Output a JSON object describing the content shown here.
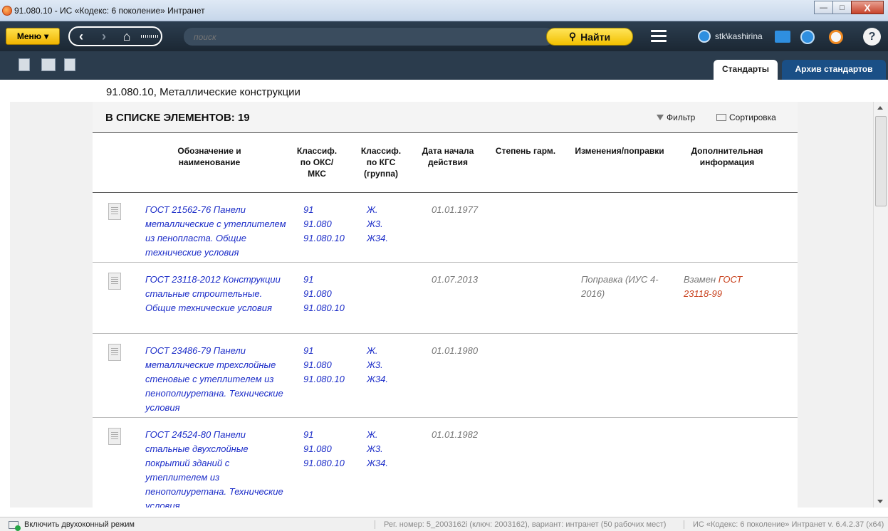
{
  "window": {
    "title": "91.080.10 - ИС «Кодекс: 6 поколение» Интранет",
    "min_label": "—",
    "max_label": "□",
    "close_label": "X"
  },
  "toolbar": {
    "menu_label": "Меню",
    "search_placeholder": "поиск",
    "search_button": "Найти",
    "user": "stk\\kashirina"
  },
  "tabs": [
    "Стандарты",
    "Архив стандартов"
  ],
  "breadcrumb": "91.080.10, Металлические конструкции",
  "list": {
    "count_label": "В СПИСКЕ ЭЛЕМЕНТОВ: 19",
    "filter_label": "Фильтр",
    "sort_label": "Сортировка",
    "columns": [
      "Обозначение и наименование",
      "Классиф. по ОКС/МКС",
      "Классиф. по КГС (группа)",
      "Дата начала действия",
      "Степень гарм.",
      "Изменения/поправки",
      "Дополнительная информация"
    ],
    "rows": [
      {
        "name": "ГОСТ 21562-76 Панели металлические с утеплителем из пенопласта. Общие технические условия",
        "oks": [
          "91",
          "91.080",
          "91.080.10"
        ],
        "kgs": [
          "Ж.",
          "Ж3.",
          "Ж34."
        ],
        "date": "01.01.1977",
        "harm": "",
        "changes": "",
        "info_prefix": "",
        "info_link": ""
      },
      {
        "name": "ГОСТ 23118-2012 Конструкции стальные строительные. Общие технические условия",
        "oks": [
          "91",
          "91.080",
          "91.080.10"
        ],
        "kgs": [],
        "date": "01.07.2013",
        "harm": "",
        "changes": "Поправка (ИУС 4-2016)",
        "info_prefix": "Взамен ",
        "info_link": "ГОСТ 23118-99"
      },
      {
        "name": "ГОСТ 23486-79 Панели металлические трехслойные стеновые с утеплителем из пенополиуретана. Технические условия",
        "oks": [
          "91",
          "91.080",
          "91.080.10"
        ],
        "kgs": [
          "Ж.",
          "Ж3.",
          "Ж34."
        ],
        "date": "01.01.1980",
        "harm": "",
        "changes": "",
        "info_prefix": "",
        "info_link": ""
      },
      {
        "name": "ГОСТ 24524-80 Панели стальные двухслойные покрытий зданий с утеплителем из пенополиуретана. Технические условия",
        "oks": [
          "91",
          "91.080",
          "91.080.10"
        ],
        "kgs": [
          "Ж.",
          "Ж3.",
          "Ж34."
        ],
        "date": "01.01.1982",
        "harm": "",
        "changes": "",
        "info_prefix": "",
        "info_link": ""
      }
    ]
  },
  "statusbar": {
    "dual_mode": "Включить двухоконный режим",
    "registration": "Рег. номер: 5_2003162i (ключ: 2003162), вариант: интранет (50 рабочих мест)",
    "version": "ИС «Кодекс: 6 поколение» Интранет v. 6.4.2.37 (x64)"
  }
}
